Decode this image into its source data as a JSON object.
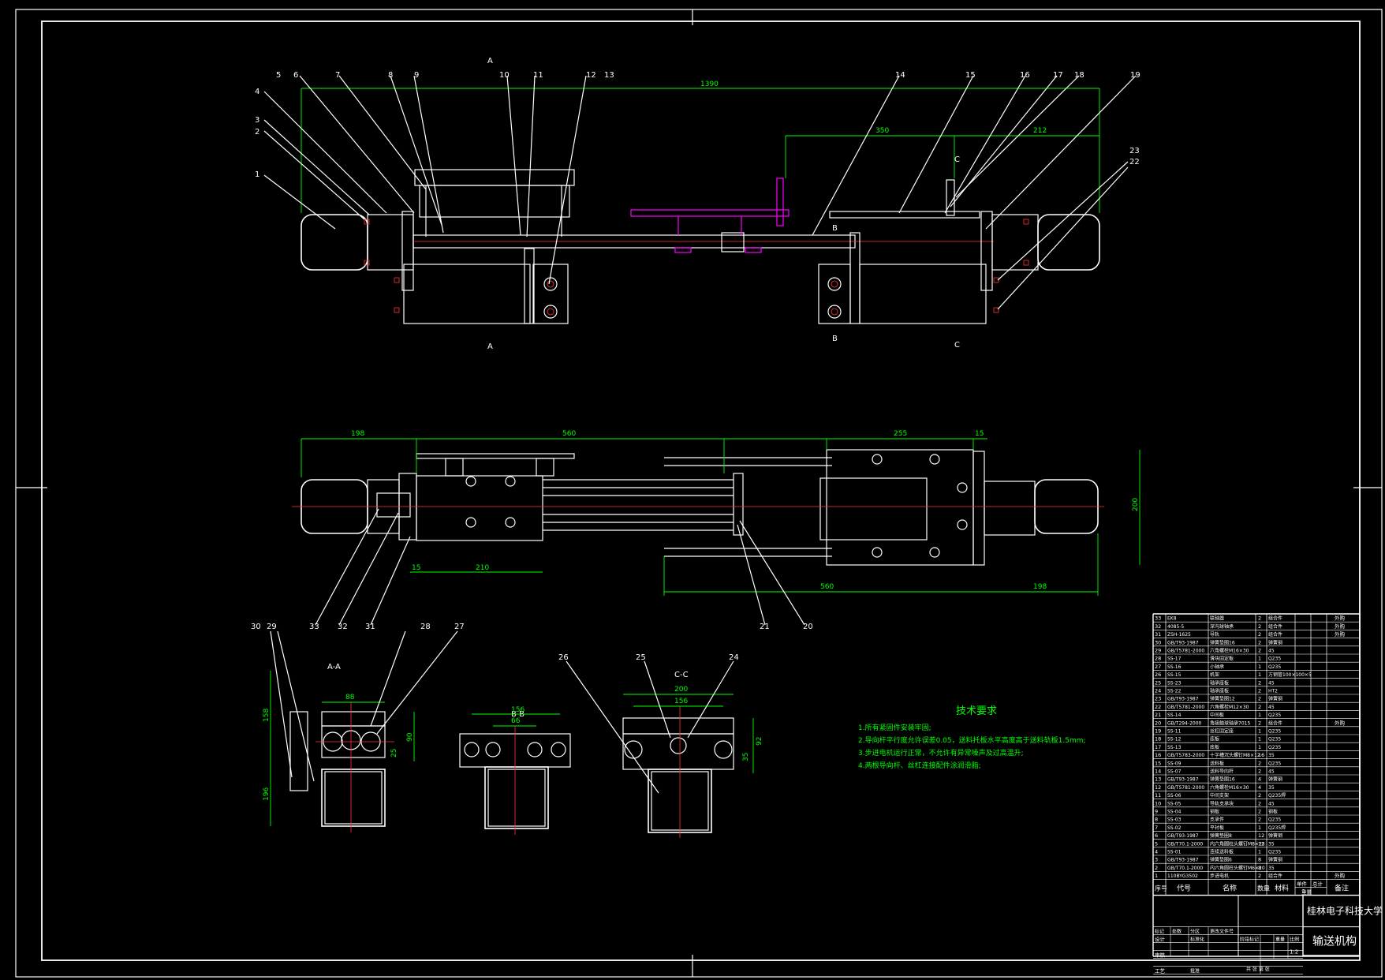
{
  "tech_requirements": {
    "title": "技术要求",
    "items": [
      "1.所有紧固件安装牢固;",
      "2.导向杆平行度允许误差0.05，送料托板水平高度高于送料轨板1.5mm;",
      "3.步进电机运行正常，不允许有异常噪声及过高温升;",
      "4.两根导向杆、丝杠连接配件涂润滑脂;"
    ]
  },
  "section_labels": {
    "aa": "A-A",
    "bb": "B-B",
    "cc": "C-C",
    "a": "A",
    "b": "B",
    "c": "C"
  },
  "dimensions": {
    "top_total": "1390",
    "top_350": "350",
    "top_212": "212",
    "mid_198a": "198",
    "mid_560a": "560",
    "mid_255": "255",
    "mid_15a": "15",
    "mid_200": "200",
    "mid_15b": "15",
    "mid_210": "210",
    "mid_560b": "560",
    "mid_198b": "198",
    "aa_88": "88",
    "aa_158": "158",
    "aa_90": "90",
    "aa_25": "25",
    "aa_196": "196",
    "bb_156": "156",
    "bb_66": "66",
    "cc_200": "200",
    "cc_156": "156",
    "cc_92": "92",
    "cc_35": "35"
  },
  "balloons": {
    "top": [
      "1",
      "2",
      "3",
      "4",
      "5",
      "6",
      "7",
      "8",
      "9",
      "10",
      "11",
      "12",
      "13",
      "14",
      "15",
      "16",
      "17",
      "18",
      "19",
      "22",
      "23"
    ],
    "mid": [
      "33",
      "32",
      "31",
      "21",
      "20"
    ],
    "bottom": [
      "30",
      "29",
      "28",
      "27",
      "26",
      "25",
      "24"
    ]
  },
  "bom": {
    "rows": [
      [
        "33",
        "EK8",
        "联轴器",
        "2",
        "组合件",
        "",
        "外购"
      ],
      [
        "32",
        "4085-5",
        "深沟球轴承",
        "2",
        "组合件",
        "",
        "外购"
      ],
      [
        "31",
        "ZSH-1625",
        "导轨",
        "2",
        "组合件",
        "",
        "外购"
      ],
      [
        "30",
        "GB/T93-1987",
        "弹簧垫圈16",
        "2",
        "弹簧钢",
        "",
        ""
      ],
      [
        "29",
        "GB/T5781-2000",
        "六角螺栓M16×30",
        "2",
        "45",
        "",
        ""
      ],
      [
        "28",
        "SS-17",
        "滑块固定板",
        "1",
        "Q235",
        "",
        ""
      ],
      [
        "27",
        "SS-16",
        "小轴承",
        "1",
        "Q235",
        "",
        ""
      ],
      [
        "26",
        "SS-15",
        "机架",
        "1",
        "方钢管100×100×5",
        "",
        ""
      ],
      [
        "25",
        "SS-23",
        "轴承座板",
        "2",
        "45",
        "",
        ""
      ],
      [
        "24",
        "SS-22",
        "轴承座板",
        "2",
        "HT2",
        "",
        ""
      ],
      [
        "23",
        "GB/T93-1987",
        "弹簧垫圈12",
        "2",
        "弹簧钢",
        "",
        ""
      ],
      [
        "22",
        "GB/T5781-2000",
        "六角螺栓M12×30",
        "2",
        "45",
        "",
        ""
      ],
      [
        "21",
        "SS-14",
        "中间板",
        "1",
        "Q235",
        "",
        ""
      ],
      [
        "20",
        "GB/T294-2000",
        "角接触球轴承7015",
        "2",
        "组合件",
        "",
        "外购"
      ],
      [
        "19",
        "SS-11",
        "丝杠固定座",
        "1",
        "Q235",
        "",
        ""
      ],
      [
        "18",
        "SS-12",
        "底板",
        "1",
        "Q235",
        "",
        ""
      ],
      [
        "17",
        "SS-13",
        "底板",
        "1",
        "Q235",
        "",
        ""
      ],
      [
        "16",
        "GB/T5783-2000",
        "十字槽沉头螺钉M8×12",
        "16",
        "35",
        "",
        ""
      ],
      [
        "15",
        "SS-09",
        "送料板",
        "2",
        "Q235",
        "",
        ""
      ],
      [
        "14",
        "SS-07",
        "送料导向杆",
        "2",
        "45",
        "",
        ""
      ],
      [
        "13",
        "GB/T93-1987",
        "弹簧垫圈16",
        "4",
        "弹簧钢",
        "",
        ""
      ],
      [
        "12",
        "GB/T5781-2000",
        "六角螺栓M16×30",
        "4",
        "35",
        "",
        ""
      ],
      [
        "11",
        "SS-06",
        "中间支架",
        "2",
        "Q235焊",
        "",
        ""
      ],
      [
        "10",
        "SS-05",
        "导轨支承块",
        "2",
        "45",
        "",
        ""
      ],
      [
        "9",
        "SS-04",
        "钢板",
        "2",
        "钢板",
        "",
        ""
      ],
      [
        "8",
        "SS-03",
        "支承件",
        "2",
        "Q235",
        "",
        ""
      ],
      [
        "7",
        "SS-02",
        "平衬板",
        "1",
        "Q235焊",
        "",
        ""
      ],
      [
        "6",
        "GB/T93-1987",
        "弹簧垫圈8",
        "12",
        "弹簧钢",
        "",
        ""
      ],
      [
        "5",
        "GB/T70.1-2000",
        "内六角圆柱头螺钉M8×25",
        "12",
        "35",
        "",
        ""
      ],
      [
        "4",
        "SS-01",
        "连续送料板",
        "1",
        "Q235",
        "",
        ""
      ],
      [
        "3",
        "GB/T93-1987",
        "弹簧垫圈6",
        "8",
        "弹簧钢",
        "",
        ""
      ],
      [
        "2",
        "GB/T70.1-2000",
        "内六角圆柱头螺钉M6×20",
        "8",
        "35",
        "",
        ""
      ],
      [
        "1",
        "110BYG3502",
        "步进电机",
        "2",
        "组合件",
        "",
        "外购"
      ]
    ],
    "header": {
      "no": "序号",
      "code": "代号",
      "name": "名称",
      "qty": "数量",
      "material": "材料",
      "unit": "单件",
      "total": "总计",
      "weight": "重量",
      "note": "备注"
    },
    "university": "桂林电子科技大学",
    "drawing_name": "输送机构",
    "scale": "1:2",
    "labels": {
      "design": "设计",
      "check": "审核",
      "process": "工艺",
      "std": "标准化",
      "approve": "批准",
      "stage_mark": "阶段标记",
      "weight": "重量",
      "scale": "比例",
      "sheet": "共 张 第 张",
      "mark": "标记",
      "count": "处数",
      "zone": "分区",
      "change": "更改文件号",
      "sign": "签名",
      "date": "年.月.日"
    }
  }
}
